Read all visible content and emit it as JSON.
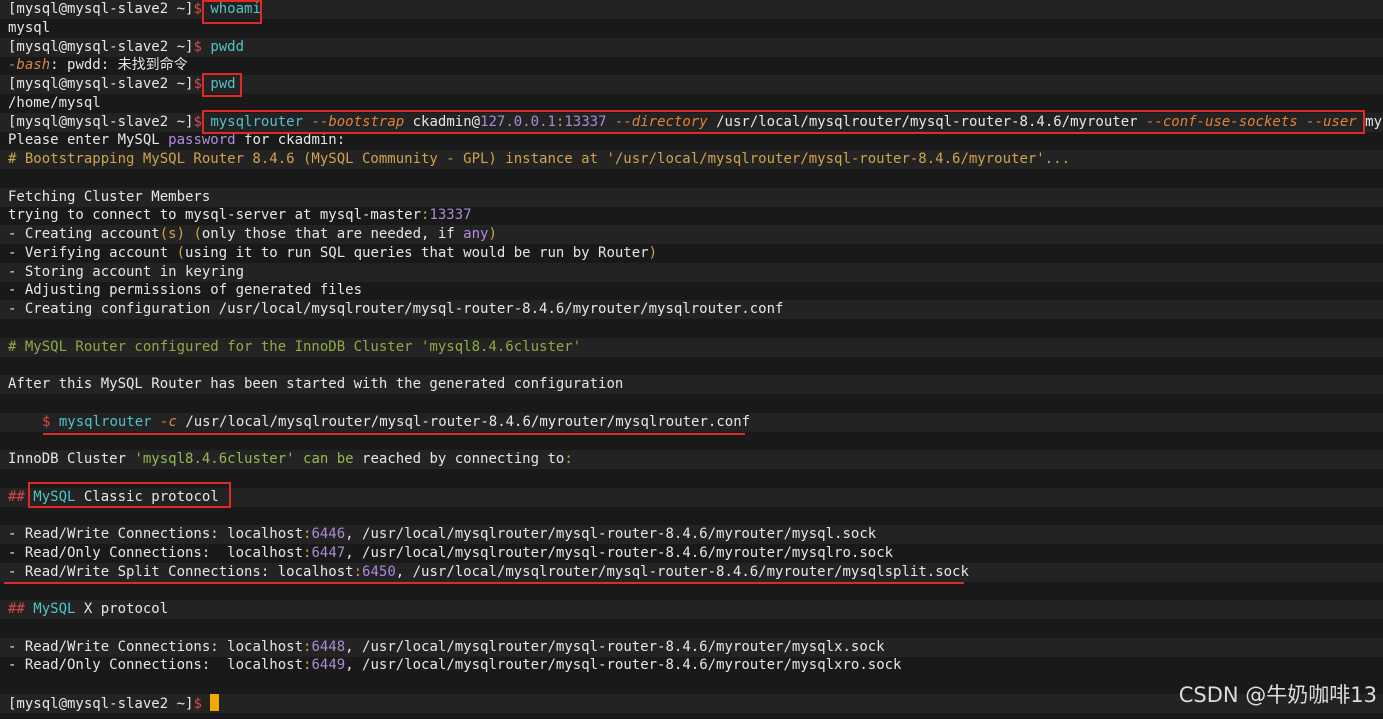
{
  "prompt": "[mysql@mysql-slave2 ~]",
  "dollar": "$",
  "cmd_whoami": "whoami",
  "out_whoami": "mysql",
  "cmd_pwdd": "pwdd",
  "err_bash": "-bash",
  "err_rest": ": pwdd: 未找到命令",
  "cmd_pwd": "pwd",
  "out_pwd": "/home/mysql",
  "cmd_router": {
    "bin": "mysqlrouter",
    "f_bootstrap": "--bootstrap",
    "user_host": "ckadmin@",
    "ip": "127.0.0.1",
    "colon": ":",
    "port": "13337",
    "f_directory": "--directory",
    "dir": "/usr/local/mysqlrouter/mysql-router-8.4.6/myrouter",
    "f_sockets": "--conf-use-sockets",
    "f_user": "--user",
    "user": "mysql"
  },
  "pw_a": "Please enter MySQL ",
  "pw_b": "password",
  "pw_c": " for ckadmin:",
  "bootstrap_comment": "# Bootstrapping MySQL Router 8.4.6 (MySQL Community - GPL) instance at '/usr/local/mysqlrouter/mysql-router-8.4.6/myrouter'...",
  "fetching": "Fetching Cluster Members",
  "trying_a": "trying to connect to mysql-server at mysql-master",
  "trying_colon": ":",
  "trying_port": "13337",
  "steps": {
    "s1a": "- Creating account",
    "s1b": "(s)",
    "s1c": " (",
    "s1d": "only those that are needed, if ",
    "s1e": "any",
    "s1f": ")",
    "s2a": "- Verifying account ",
    "s2b": "(",
    "s2c": "using it to run SQL queries that would be run by Router",
    "s2d": ")",
    "s3": "- Storing account in keyring",
    "s4": "- Adjusting permissions of generated files",
    "s5": "- Creating configuration /usr/local/mysqlrouter/mysql-router-8.4.6/myrouter/mysqlrouter.conf"
  },
  "configured_comment": "# MySQL Router configured for the InnoDB Cluster 'mysql8.4.6cluster'",
  "after_started": "After this MySQL Router has been started with the generated configuration",
  "run_cmd": {
    "dollar": "$",
    "bin": "mysqlrouter",
    "flag": "-c",
    "path": "/usr/local/mysqlrouter/mysql-router-8.4.6/myrouter/mysqlrouter.conf"
  },
  "innodb": {
    "a": "InnoDB Cluster ",
    "name": "'mysql8.4.6cluster'",
    "b": " can be",
    "c": " reached by connecting to",
    "d": ":"
  },
  "classic": {
    "hash": "##",
    "mysql": "MySQL",
    "rest": " Classic protocol"
  },
  "classic_rows": [
    {
      "label": "- Read/Write Connections",
      "sep": ": localhost",
      "colon": ":",
      "port": "6446",
      "rest": ", /usr/local/mysqlrouter/mysql-router-8.4.6/myrouter/mysql.sock"
    },
    {
      "label": "- Read/Only Connections",
      "sep": ":  localhost",
      "colon": ":",
      "port": "6447",
      "rest": ", /usr/local/mysqlrouter/mysql-router-8.4.6/myrouter/mysqlro.sock"
    },
    {
      "label": "- Read/Write Split Connections",
      "sep": ": localhost",
      "colon": ":",
      "port": "6450",
      "rest": ", /usr/local/mysqlrouter/mysql-router-8.4.6/myrouter/mysqlsplit.sock"
    }
  ],
  "xproto": {
    "hash": "##",
    "mysql": "MySQL",
    "rest": " X protocol"
  },
  "x_rows": [
    {
      "label": "- Read/Write Connections",
      "sep": ": localhost",
      "colon": ":",
      "port": "6448",
      "rest": ", /usr/local/mysqlrouter/mysql-router-8.4.6/myrouter/mysqlx.sock"
    },
    {
      "label": "- Read/Only Connections",
      "sep": ":  localhost",
      "colon": ":",
      "port": "6449",
      "rest": ", /usr/local/mysqlrouter/mysql-router-8.4.6/myrouter/mysqlxro.sock"
    }
  ],
  "watermark": "CSDN @牛奶咖啡13",
  "colors": {
    "background": "#191919",
    "highlight_box": "#e02a2a",
    "command": "#4fc3c8",
    "flag": "#e0813a",
    "number": "#a98bd6",
    "cursor": "#f2a900"
  }
}
